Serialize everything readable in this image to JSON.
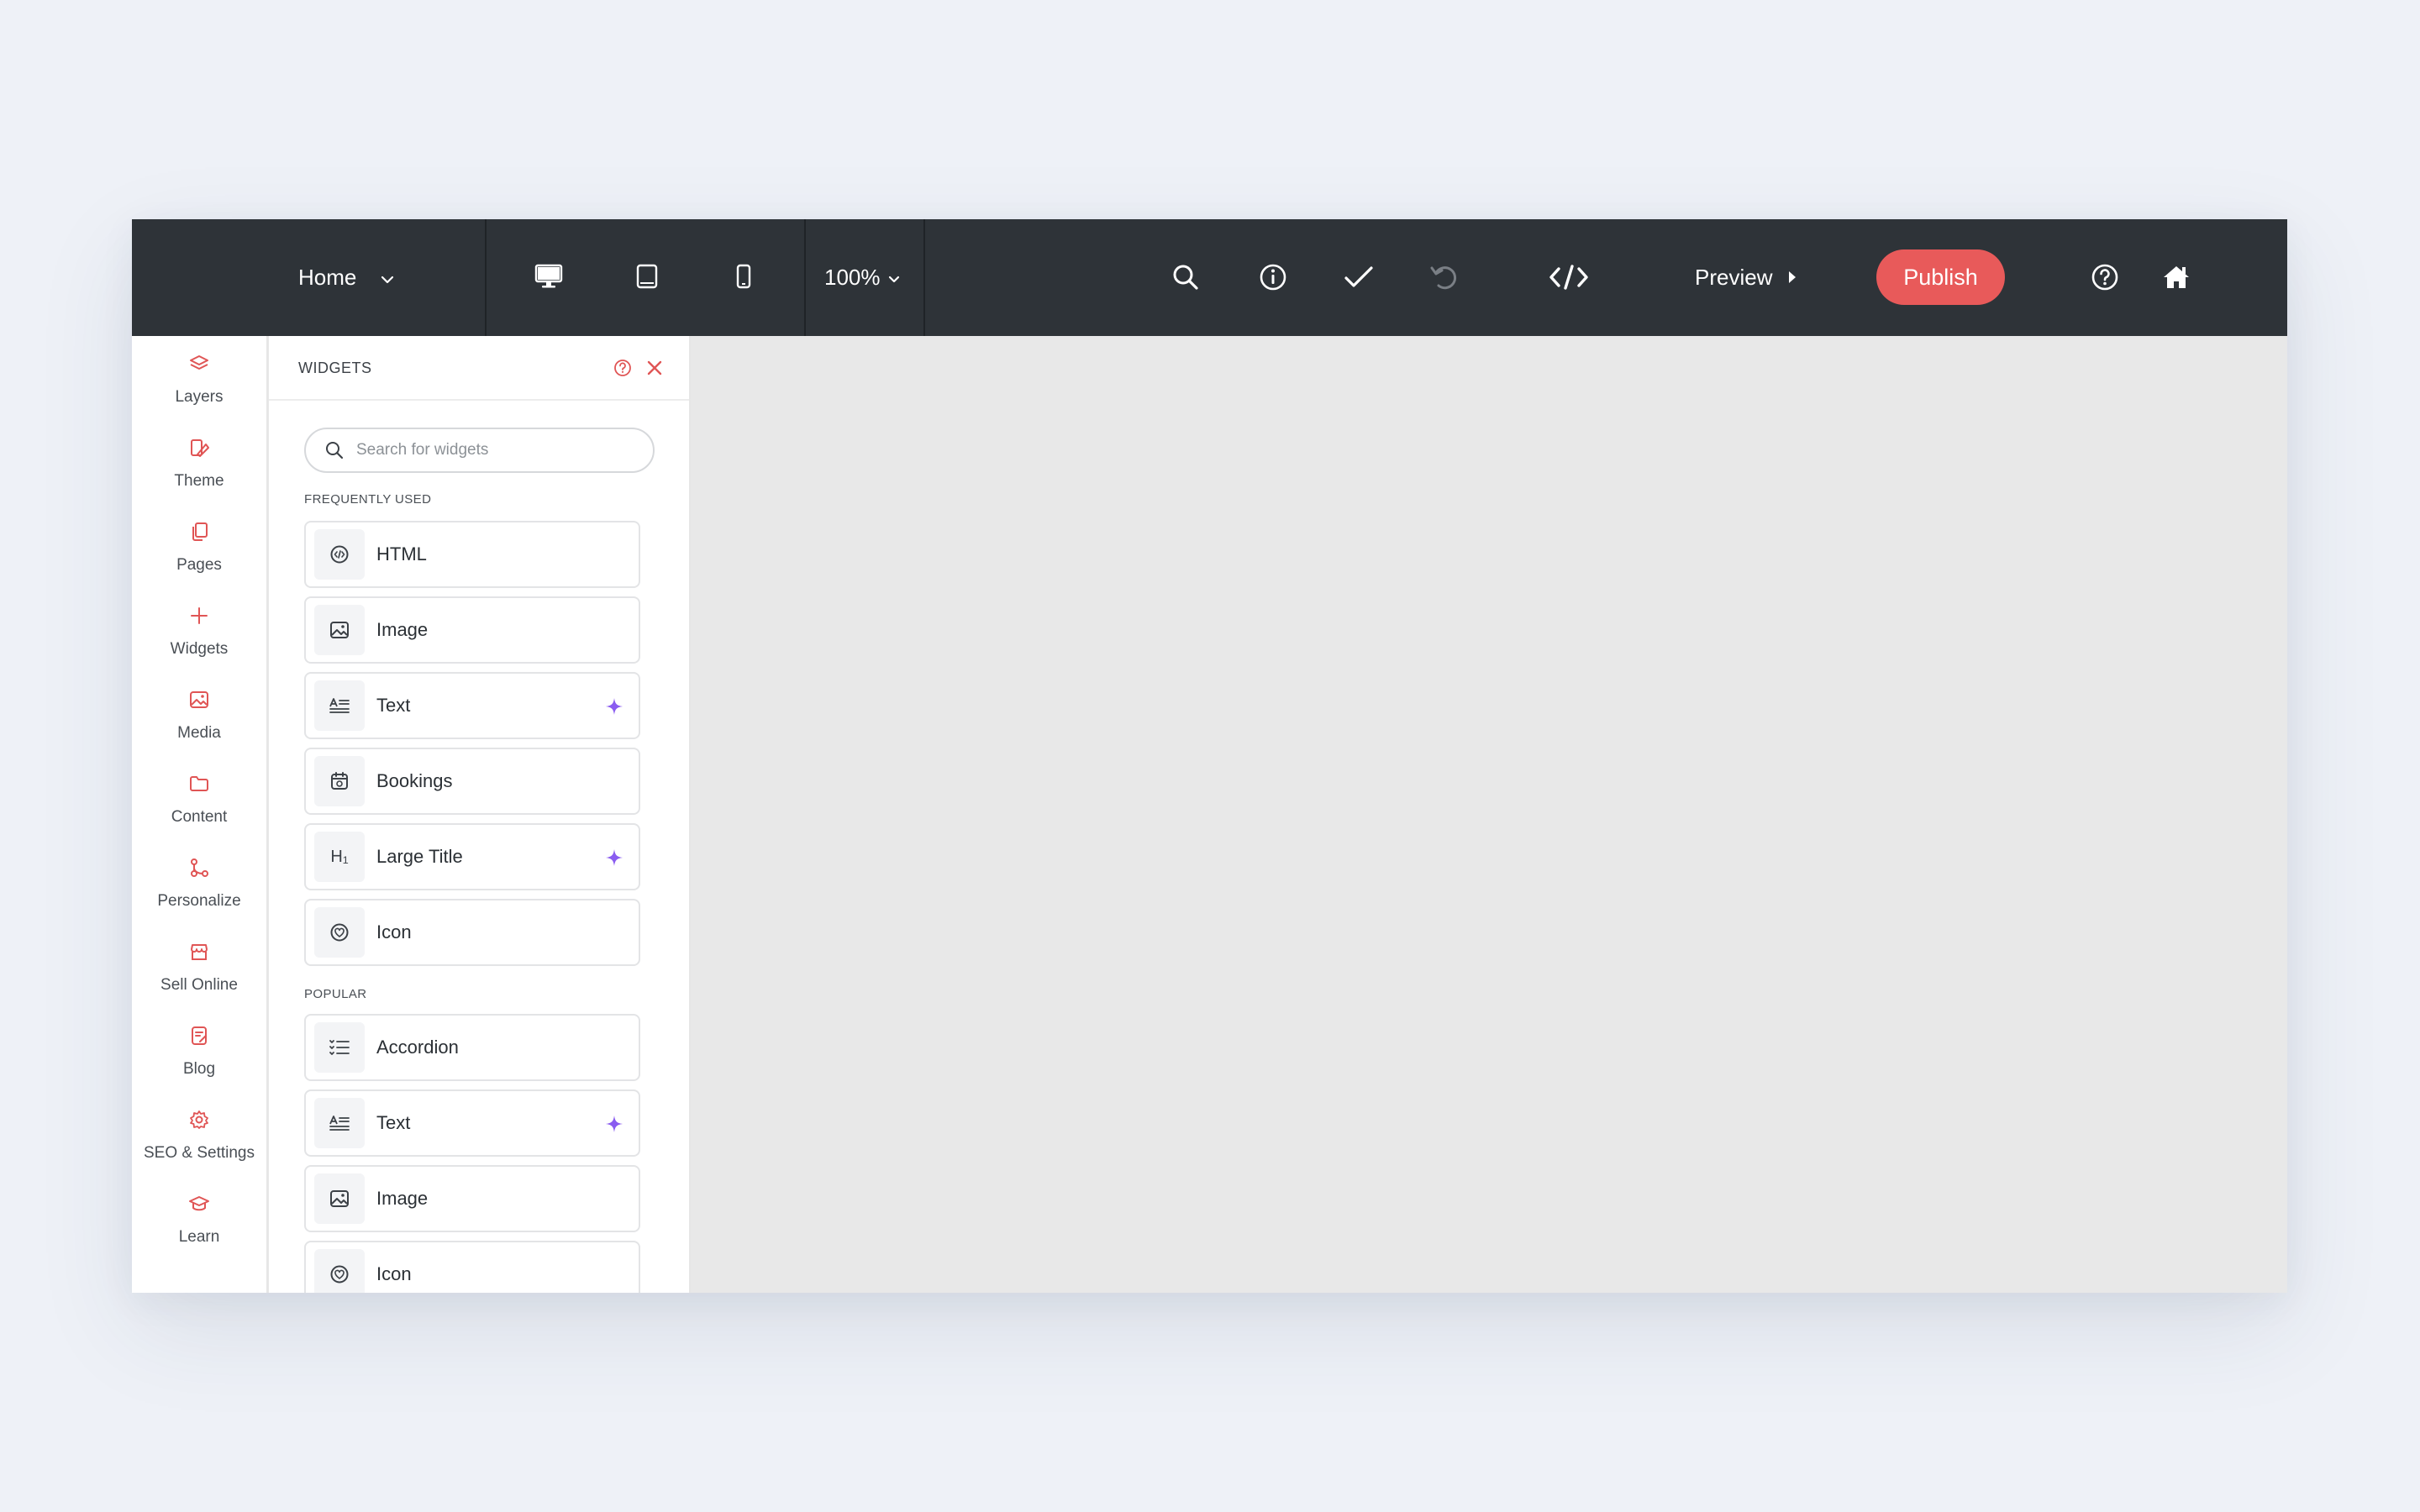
{
  "topbar": {
    "page_select": "Home",
    "zoom": "100%",
    "preview_label": "Preview",
    "publish_label": "Publish"
  },
  "rail": {
    "items": [
      {
        "label": "Layers",
        "icon": "layers-icon"
      },
      {
        "label": "Theme",
        "icon": "theme-icon"
      },
      {
        "label": "Pages",
        "icon": "pages-icon"
      },
      {
        "label": "Widgets",
        "icon": "plus-icon"
      },
      {
        "label": "Media",
        "icon": "media-icon"
      },
      {
        "label": "Content",
        "icon": "folder-icon"
      },
      {
        "label": "Personalize",
        "icon": "personalize-icon"
      },
      {
        "label": "Sell Online",
        "icon": "store-icon"
      },
      {
        "label": "Blog",
        "icon": "blog-icon"
      },
      {
        "label": "SEO & Settings",
        "icon": "gear-icon"
      },
      {
        "label": "Learn",
        "icon": "graduation-cap-icon"
      }
    ]
  },
  "panel": {
    "title": "WIDGETS",
    "search_placeholder": "Search for widgets",
    "sections": [
      {
        "label": "FREQUENTLY USED",
        "items": [
          {
            "label": "HTML",
            "icon": "html-icon",
            "ai": false
          },
          {
            "label": "Image",
            "icon": "image-icon",
            "ai": false
          },
          {
            "label": "Text",
            "icon": "text-icon",
            "ai": true
          },
          {
            "label": "Bookings",
            "icon": "calendar-icon",
            "ai": false
          },
          {
            "label": "Large Title",
            "icon": "heading-icon",
            "glyph": "H₁",
            "ai": true
          },
          {
            "label": "Icon",
            "icon": "heart-icon",
            "ai": false
          }
        ]
      },
      {
        "label": "POPULAR",
        "items": [
          {
            "label": "Accordion",
            "icon": "accordion-icon",
            "ai": false
          },
          {
            "label": "Text",
            "icon": "text-icon",
            "ai": true
          },
          {
            "label": "Image",
            "icon": "image-icon",
            "ai": false
          },
          {
            "label": "Icon",
            "icon": "heart-icon",
            "ai": false
          }
        ]
      }
    ]
  },
  "colors": {
    "topbar_bg": "#2e3338",
    "accent": "#e85a5a",
    "ai_sparkle": "#8a5cf0",
    "canvas_bg": "#e8e8e8",
    "page_bg": "#eef1f7"
  }
}
